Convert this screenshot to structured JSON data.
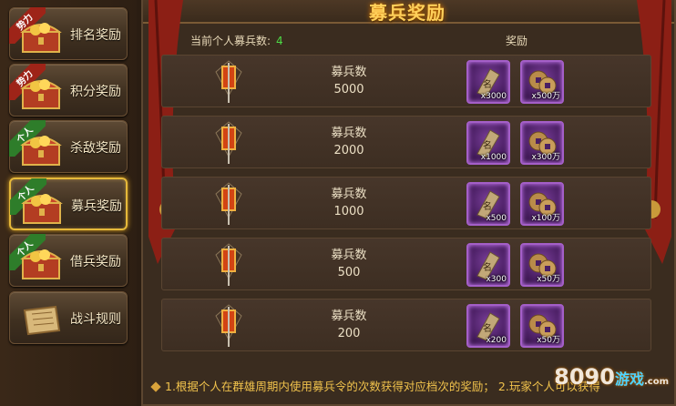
{
  "sidebar": {
    "items": [
      {
        "label": "排名奖励",
        "tag": "势力",
        "tag_color": "red"
      },
      {
        "label": "积分奖励",
        "tag": "势力",
        "tag_color": "red"
      },
      {
        "label": "杀敌奖励",
        "tag": "个人",
        "tag_color": "green"
      },
      {
        "label": "募兵奖励",
        "tag": "个人",
        "tag_color": "green",
        "active": true
      },
      {
        "label": "借兵奖励",
        "tag": "个人",
        "tag_color": "green"
      },
      {
        "label": "战斗规则",
        "tag": ""
      }
    ]
  },
  "main": {
    "title": "募兵奖励",
    "current_label": "当前个人募兵数:",
    "current_value": "4",
    "reward_header": "奖励",
    "rows": [
      {
        "req_label": "募兵数",
        "req_value": "5000",
        "rewards": [
          "x3000",
          "x500万"
        ]
      },
      {
        "req_label": "募兵数",
        "req_value": "2000",
        "rewards": [
          "x1000",
          "x300万"
        ]
      },
      {
        "req_label": "募兵数",
        "req_value": "1000",
        "rewards": [
          "x500",
          "x100万"
        ]
      },
      {
        "req_label": "募兵数",
        "req_value": "500",
        "rewards": [
          "x300",
          "x50万"
        ]
      },
      {
        "req_label": "募兵数",
        "req_value": "200",
        "rewards": [
          "x200",
          "x50万"
        ]
      }
    ],
    "footer": "1.根据个人在群雄周期内使用募兵令的次数获得对应档次的奖励； 2.玩家个人可以获得"
  },
  "watermark": {
    "number": "8090",
    "brand": "游戏",
    "domain": ".com"
  },
  "colors": {
    "accent": "#ffd05a",
    "active_border": "#e6b93a",
    "count": "#4ddb46",
    "reward_frame": "#a45fc8"
  }
}
